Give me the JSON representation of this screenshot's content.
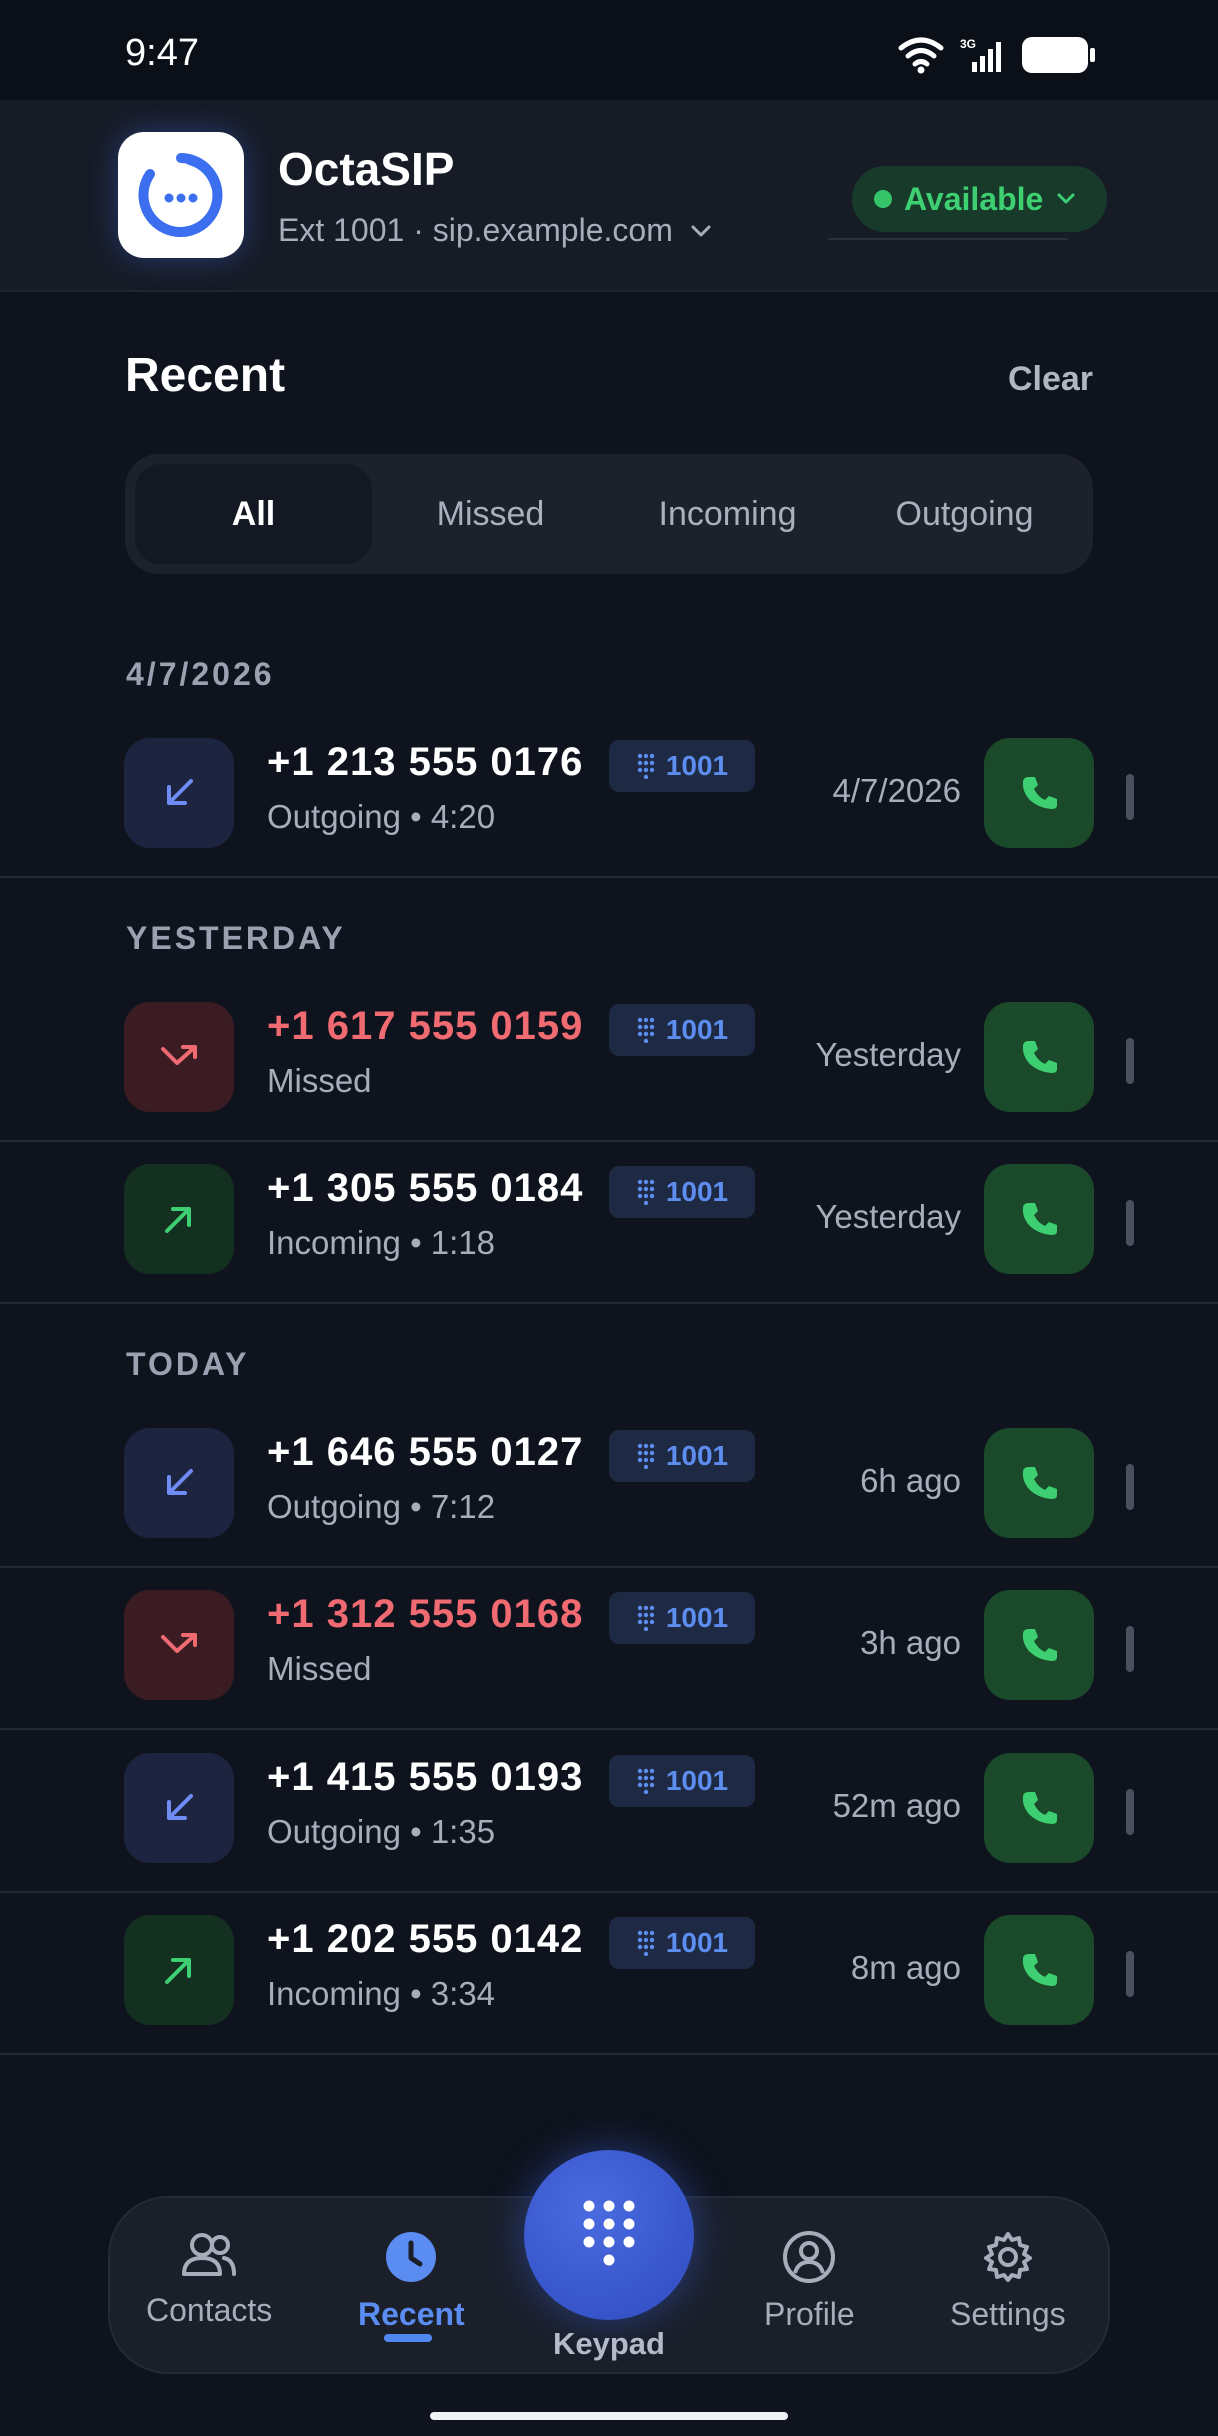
{
  "status_bar": {
    "time": "9:47",
    "network": "3G"
  },
  "header": {
    "app_name": "OctaSIP",
    "account": "Ext 1001 · sip.example.com",
    "status": "Available"
  },
  "section": {
    "title": "Recent",
    "clear_label": "Clear"
  },
  "tabs": [
    {
      "label": "All",
      "active": true
    },
    {
      "label": "Missed",
      "active": false
    },
    {
      "label": "Incoming",
      "active": false
    },
    {
      "label": "Outgoing",
      "active": false
    }
  ],
  "groups": [
    {
      "date": "4/7/2026",
      "calls": [
        {
          "number": "+1 213 555 0176",
          "type": "outgoing",
          "detail": "Outgoing • 4:20",
          "ext": "1001",
          "time": "4/7/2026"
        }
      ]
    },
    {
      "date": "YESTERDAY",
      "calls": [
        {
          "number": "+1 617 555 0159",
          "type": "missed",
          "detail": "Missed",
          "ext": "1001",
          "time": "Yesterday"
        },
        {
          "number": "+1 305 555 0184",
          "type": "incoming",
          "detail": "Incoming • 1:18",
          "ext": "1001",
          "time": "Yesterday"
        }
      ]
    },
    {
      "date": "TODAY",
      "calls": [
        {
          "number": "+1 646 555 0127",
          "type": "outgoing",
          "detail": "Outgoing • 7:12",
          "ext": "1001",
          "time": "6h ago"
        },
        {
          "number": "+1 312 555 0168",
          "type": "missed",
          "detail": "Missed",
          "ext": "1001",
          "time": "3h ago"
        },
        {
          "number": "+1 415 555 0193",
          "type": "outgoing",
          "detail": "Outgoing • 1:35",
          "ext": "1001",
          "time": "52m ago"
        },
        {
          "number": "+1 202 555 0142",
          "type": "incoming",
          "detail": "Incoming • 3:34",
          "ext": "1001",
          "time": "8m ago"
        }
      ]
    }
  ],
  "nav": {
    "contacts": "Contacts",
    "recent": "Recent",
    "keypad": "Keypad",
    "profile": "Profile",
    "settings": "Settings"
  },
  "colors": {
    "background": "#0f131d",
    "accent": "#4f86f0",
    "available_green": "#3ecf72",
    "missed_red": "#f06a72",
    "call_button_bg": "#1a4a2a"
  },
  "icons": {
    "outgoing": "arrow-down-left-icon",
    "incoming": "arrow-up-right-icon",
    "missed": "missed-call-icon",
    "call": "phone-icon",
    "ext": "dialpad-icon"
  }
}
